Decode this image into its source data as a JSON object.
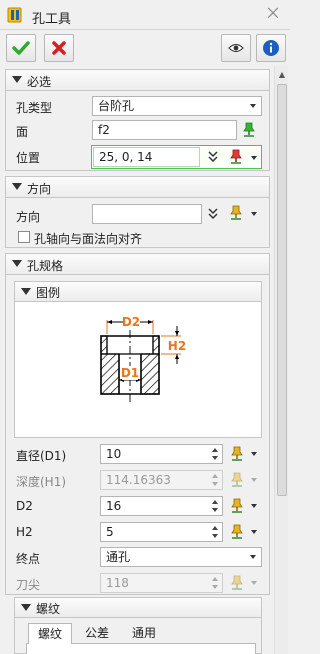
{
  "window": {
    "title": "孔工具",
    "close_glyph": "⨉",
    "app_icon": "ruler-icon"
  },
  "toolbar": {
    "ok_icon": "check-icon",
    "cancel_icon": "x-icon",
    "preview_icon": "eye-icon",
    "help_icon": "info-icon"
  },
  "sections": {
    "required": {
      "header": "必选",
      "hole_type": {
        "label": "孔类型",
        "value": "台阶孔"
      },
      "face": {
        "label": "面",
        "value": "f2"
      },
      "position": {
        "label": "位置",
        "value": "25, 0, 14"
      }
    },
    "direction": {
      "header": "方向",
      "direction_field": {
        "label": "方向",
        "value": ""
      },
      "align_checkbox": {
        "label": "孔轴向与面法向对齐",
        "checked": false
      }
    },
    "spec": {
      "header": "孔规格",
      "legend": {
        "header": "图例",
        "labels": {
          "d2": "D2",
          "h2": "H2",
          "d1": "D1"
        }
      },
      "diameter": {
        "label": "直径(D1)",
        "value": "10"
      },
      "depth": {
        "label": "深度(H1)",
        "value": "114.16363"
      },
      "d2": {
        "label": "D2",
        "value": "16"
      },
      "h2": {
        "label": "H2",
        "value": "5"
      },
      "end": {
        "label": "终点",
        "value": "通孔"
      },
      "tip": {
        "label": "刀尖",
        "value": "118"
      }
    },
    "thread": {
      "header": "螺纹",
      "tabs": [
        "螺纹",
        "公差",
        "通用"
      ],
      "active_tab": "螺纹"
    }
  },
  "colors": {
    "accent_green": "#2eaa2e",
    "cancel_red": "#d32020",
    "info_blue": "#1d5fbf",
    "dim_label": "#e8761e"
  }
}
